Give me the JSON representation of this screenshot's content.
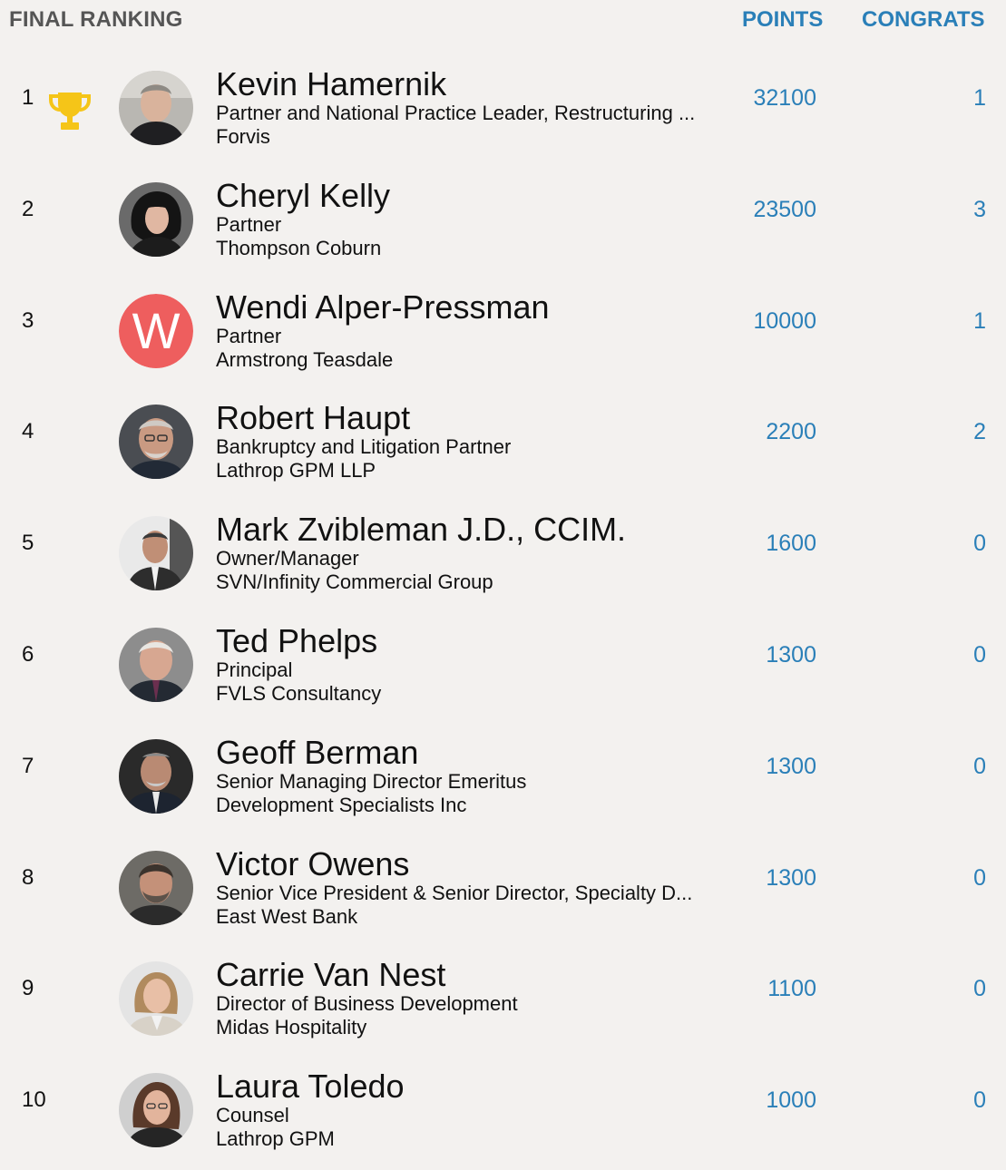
{
  "header": {
    "title": "FINAL RANKING",
    "points_label": "POINTS",
    "congrats_label": "CONGRATS"
  },
  "colors": {
    "accent": "#2a7fb8",
    "trophy": "#f5c518",
    "letter_avatar_bg": "#ee5e5e",
    "background": "#f3f1ef"
  },
  "rows": [
    {
      "rank": "1",
      "name": "Kevin Hamernik",
      "title": "Partner and National Practice Leader, Restructuring ...",
      "company": "Forvis",
      "points": "32100",
      "congrats": "1",
      "trophy_icon": "trophy-icon",
      "avatar": "photo"
    },
    {
      "rank": "2",
      "name": "Cheryl Kelly",
      "title": "Partner",
      "company": "Thompson Coburn",
      "points": "23500",
      "congrats": "3",
      "avatar": "photo"
    },
    {
      "rank": "3",
      "name": "Wendi Alper-Pressman",
      "title": "Partner",
      "company": "Armstrong Teasdale",
      "points": "10000",
      "congrats": "1",
      "avatar": "letter",
      "avatar_letter": "W"
    },
    {
      "rank": "4",
      "name": "Robert Haupt",
      "title": "Bankruptcy and Litigation Partner",
      "company": "Lathrop GPM LLP",
      "points": "2200",
      "congrats": "2",
      "avatar": "photo"
    },
    {
      "rank": "5",
      "name": "Mark Zvibleman J.D., CCIM.",
      "title": "Owner/Manager",
      "company": "SVN/Infinity Commercial Group",
      "points": "1600",
      "congrats": "0",
      "avatar": "photo"
    },
    {
      "rank": "6",
      "name": "Ted Phelps",
      "title": "Principal",
      "company": "FVLS Consultancy",
      "points": "1300",
      "congrats": "0",
      "avatar": "photo"
    },
    {
      "rank": "7",
      "name": "Geoff Berman",
      "title": "Senior Managing Director Emeritus",
      "company": "Development Specialists Inc",
      "points": "1300",
      "congrats": "0",
      "avatar": "photo"
    },
    {
      "rank": "8",
      "name": "Victor Owens",
      "title": "Senior Vice President & Senior Director, Specialty D...",
      "company": "East West Bank",
      "points": "1300",
      "congrats": "0",
      "avatar": "photo"
    },
    {
      "rank": "9",
      "name": "Carrie Van Nest",
      "title": "Director of Business Development",
      "company": "Midas Hospitality",
      "points": "1100",
      "congrats": "0",
      "avatar": "photo"
    },
    {
      "rank": "10",
      "name": "Laura Toledo",
      "title": "Counsel",
      "company": "Lathrop GPM",
      "points": "1000",
      "congrats": "0",
      "avatar": "photo"
    }
  ]
}
